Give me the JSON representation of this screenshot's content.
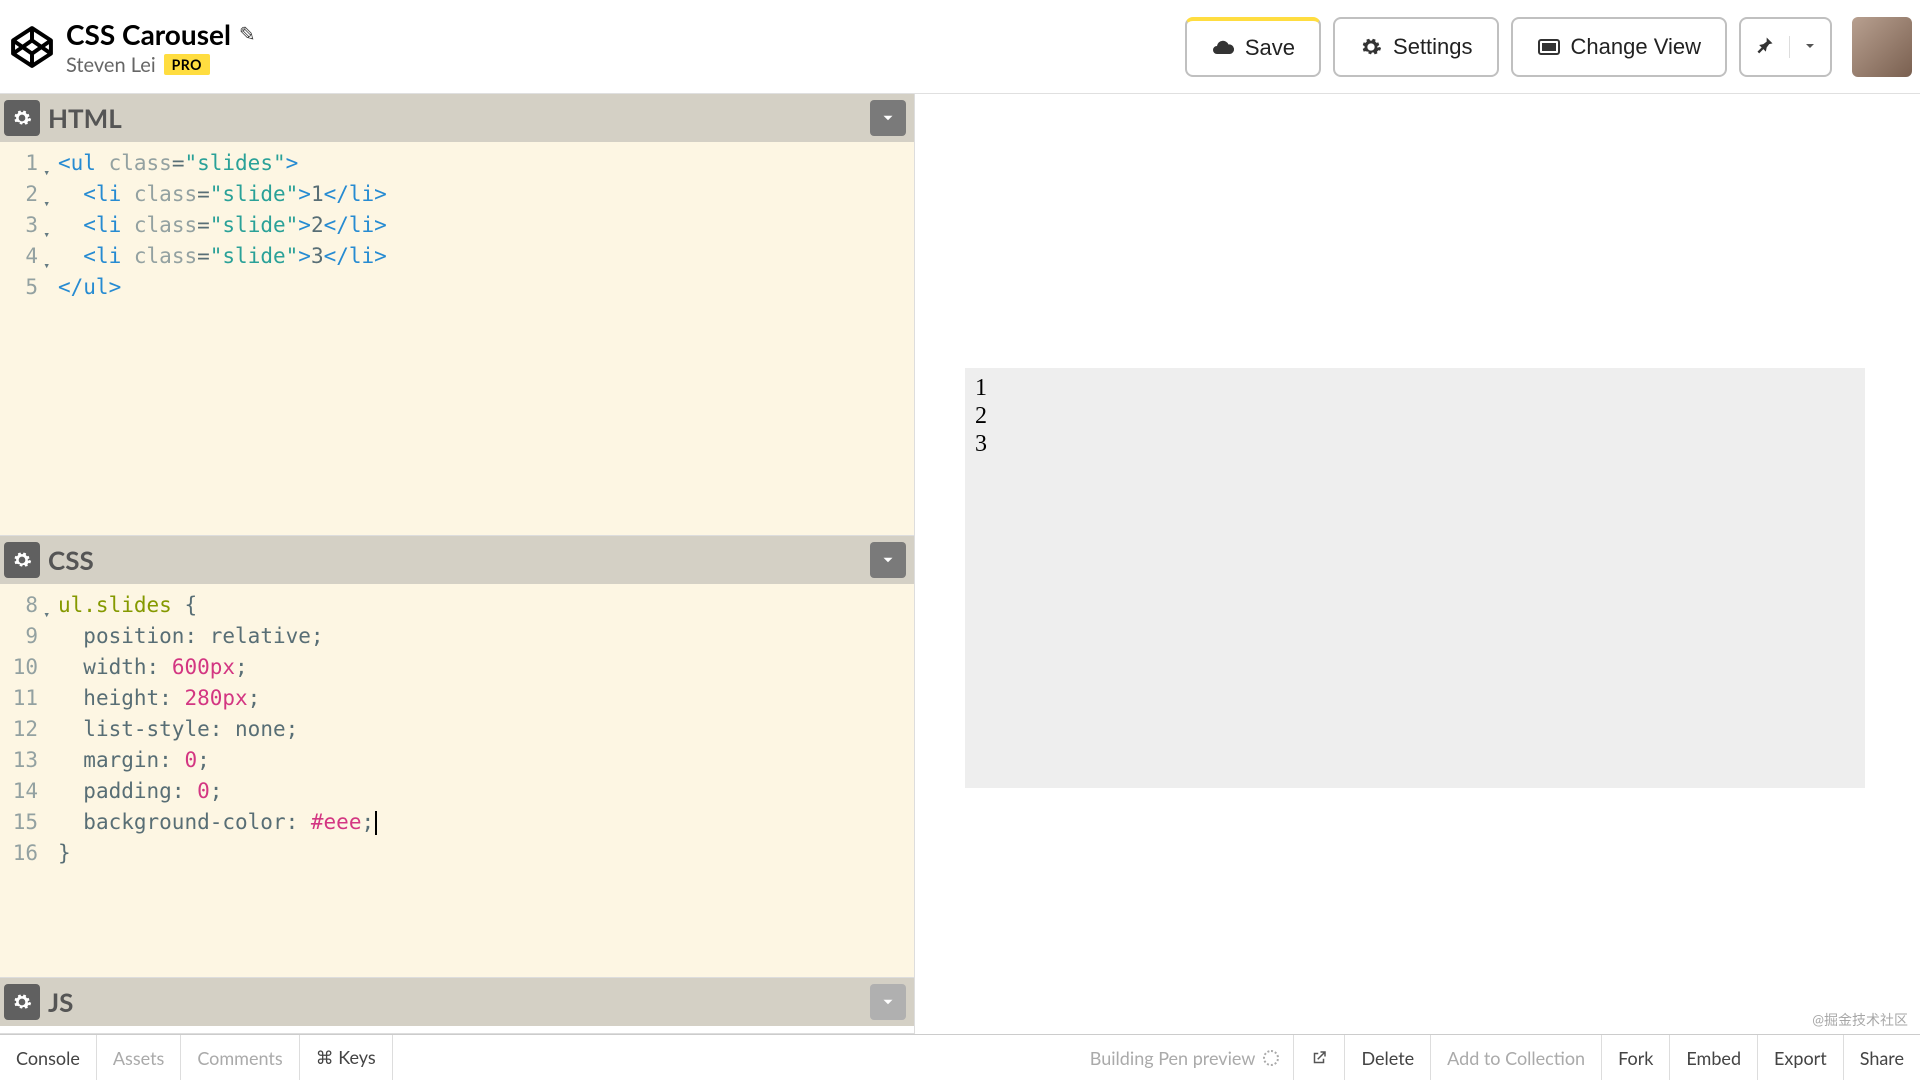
{
  "header": {
    "title": "CSS Carousel",
    "author": "Steven Lei",
    "pro": "PRO",
    "save": "Save",
    "settings": "Settings",
    "change_view": "Change View"
  },
  "panels": {
    "html": {
      "label": "HTML"
    },
    "css": {
      "label": "CSS"
    },
    "js": {
      "label": "JS"
    }
  },
  "html_code": [
    {
      "n": "1",
      "fold": true,
      "tokens": [
        [
          "tag",
          "<ul"
        ],
        [
          "punc",
          " "
        ],
        [
          "attr",
          "class"
        ],
        [
          "punc",
          "="
        ],
        [
          "str",
          "\"slides\""
        ],
        [
          "tag",
          ">"
        ]
      ]
    },
    {
      "n": "2",
      "fold": true,
      "indent": 2,
      "tokens": [
        [
          "tag",
          "<li"
        ],
        [
          "punc",
          " "
        ],
        [
          "attr",
          "class"
        ],
        [
          "punc",
          "="
        ],
        [
          "str",
          "\"slide\""
        ],
        [
          "tag",
          ">"
        ],
        [
          "punc",
          "1"
        ],
        [
          "tag",
          "</li>"
        ]
      ]
    },
    {
      "n": "3",
      "fold": true,
      "indent": 2,
      "tokens": [
        [
          "tag",
          "<li"
        ],
        [
          "punc",
          " "
        ],
        [
          "attr",
          "class"
        ],
        [
          "punc",
          "="
        ],
        [
          "str",
          "\"slide\""
        ],
        [
          "tag",
          ">"
        ],
        [
          "punc",
          "2"
        ],
        [
          "tag",
          "</li>"
        ]
      ]
    },
    {
      "n": "4",
      "fold": true,
      "indent": 2,
      "tokens": [
        [
          "tag",
          "<li"
        ],
        [
          "punc",
          " "
        ],
        [
          "attr",
          "class"
        ],
        [
          "punc",
          "="
        ],
        [
          "str",
          "\"slide\""
        ],
        [
          "tag",
          ">"
        ],
        [
          "punc",
          "3"
        ],
        [
          "tag",
          "</li>"
        ]
      ]
    },
    {
      "n": "5",
      "fold": false,
      "tokens": [
        [
          "tag",
          "</ul>"
        ]
      ]
    }
  ],
  "css_code": [
    {
      "n": "8",
      "fold": true,
      "tokens": [
        [
          "sel",
          "ul.slides"
        ],
        [
          "punc",
          " {"
        ]
      ]
    },
    {
      "n": "9",
      "indent": 2,
      "tokens": [
        [
          "prop",
          "position"
        ],
        [
          "punc",
          ": "
        ],
        [
          "prop",
          "relative"
        ],
        [
          "punc",
          ";"
        ]
      ]
    },
    {
      "n": "10",
      "indent": 2,
      "tokens": [
        [
          "prop",
          "width"
        ],
        [
          "punc",
          ": "
        ],
        [
          "num",
          "600px"
        ],
        [
          "punc",
          ";"
        ]
      ]
    },
    {
      "n": "11",
      "indent": 2,
      "tokens": [
        [
          "prop",
          "height"
        ],
        [
          "punc",
          ": "
        ],
        [
          "num",
          "280px"
        ],
        [
          "punc",
          ";"
        ]
      ]
    },
    {
      "n": "12",
      "indent": 2,
      "tokens": [
        [
          "prop",
          "list-style"
        ],
        [
          "punc",
          ": "
        ],
        [
          "prop",
          "none"
        ],
        [
          "punc",
          ";"
        ]
      ]
    },
    {
      "n": "13",
      "indent": 2,
      "tokens": [
        [
          "prop",
          "margin"
        ],
        [
          "punc",
          ": "
        ],
        [
          "num",
          "0"
        ],
        [
          "punc",
          ";"
        ]
      ]
    },
    {
      "n": "14",
      "indent": 2,
      "tokens": [
        [
          "prop",
          "padding"
        ],
        [
          "punc",
          ": "
        ],
        [
          "num",
          "0"
        ],
        [
          "punc",
          ";"
        ]
      ]
    },
    {
      "n": "15",
      "indent": 2,
      "cursor": true,
      "tokens": [
        [
          "prop",
          "background-color"
        ],
        [
          "punc",
          ": "
        ],
        [
          "num",
          "#eee"
        ],
        [
          "punc",
          ";"
        ]
      ]
    },
    {
      "n": "16",
      "tokens": [
        [
          "punc",
          "}"
        ]
      ]
    }
  ],
  "preview_items": [
    "1",
    "2",
    "3"
  ],
  "footer": {
    "console": "Console",
    "assets": "Assets",
    "comments": "Comments",
    "keys": "⌘ Keys",
    "status": "Building Pen preview",
    "delete": "Delete",
    "add": "Add to Collection",
    "fork": "Fork",
    "embed": "Embed",
    "export": "Export",
    "share": "Share"
  },
  "watermark": "@掘金技术社区"
}
